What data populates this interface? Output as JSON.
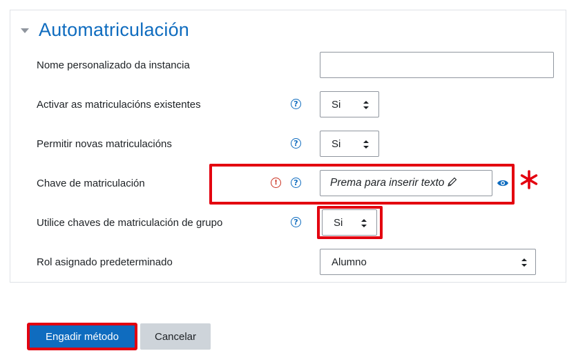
{
  "section": {
    "title": "Automatriculación"
  },
  "fields": {
    "instance_name": {
      "label": "Nome personalizado da instancia",
      "value": ""
    },
    "enable_existing": {
      "label": "Activar as matriculacións existentes",
      "value": "Si"
    },
    "allow_new": {
      "label": "Permitir novas matriculacións",
      "value": "Si"
    },
    "enrolment_key": {
      "label": "Chave de matriculación",
      "placeholder": "Prema para inserir texto"
    },
    "group_keys": {
      "label": "Utilice chaves de matriculación de grupo",
      "value": "Si"
    },
    "default_role": {
      "label": "Rol asignado predeterminado",
      "value": "Alumno"
    }
  },
  "icons": {
    "help": "?",
    "required": "!"
  },
  "buttons": {
    "submit": "Engadir método",
    "cancel": "Cancelar"
  },
  "colors": {
    "accent": "#0f6cbf",
    "highlight": "#e3000f",
    "required": "#ca3120"
  }
}
